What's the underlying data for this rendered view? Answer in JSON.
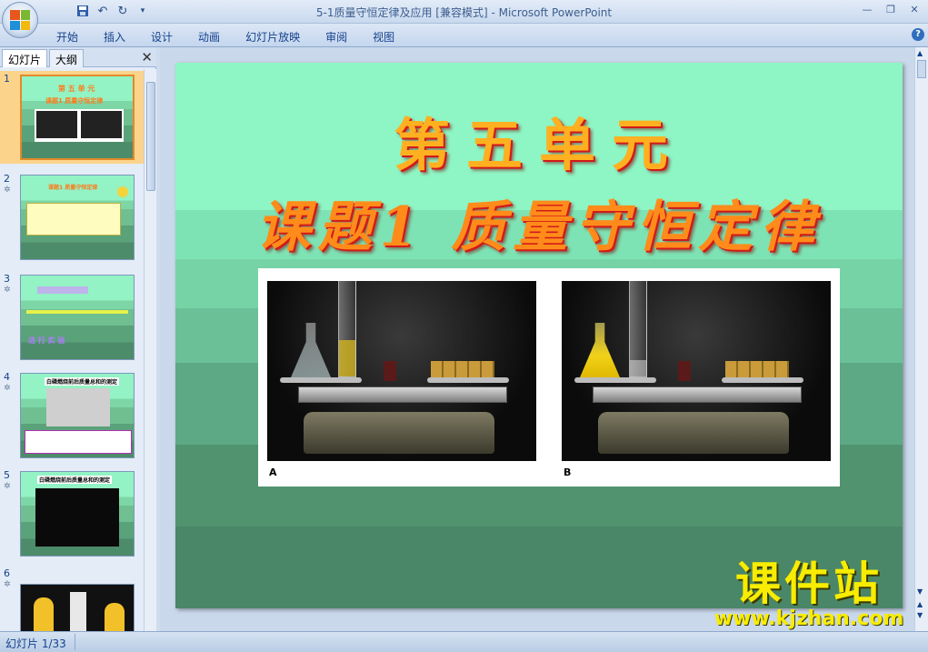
{
  "window": {
    "title": "5-1质量守恒定律及应用 [兼容模式] - Microsoft PowerPoint"
  },
  "quick_access": {
    "icons": [
      "save-icon",
      "undo-icon",
      "redo-icon",
      "customize-icon"
    ]
  },
  "ribbon": {
    "tabs": [
      "开始",
      "插入",
      "设计",
      "动画",
      "幻灯片放映",
      "审阅",
      "视图"
    ]
  },
  "left_pane": {
    "tabs": [
      "幻灯片",
      "大纲"
    ],
    "close_label": "✕",
    "thumbnails": [
      {
        "number": "1",
        "texts": [
          "第 五 单 元",
          "课题1 质量守恒定律"
        ],
        "selected": true
      },
      {
        "number": "2",
        "texts": [
          "课题1 质量守恒定律"
        ]
      },
      {
        "number": "3",
        "texts": [
          "进 行 实 验"
        ]
      },
      {
        "number": "4",
        "texts": [
          "白磷燃烧前后质量总和的测定"
        ]
      },
      {
        "number": "5",
        "texts": [
          "白磷燃烧前后质量总和的测定"
        ]
      },
      {
        "number": "6",
        "texts": []
      }
    ]
  },
  "slide": {
    "title_line1": "第五单元",
    "title_line2": "课题1 质量守恒定律",
    "photo_labels": [
      "A",
      "B"
    ]
  },
  "watermark": {
    "brand": "课件站",
    "url": "www.kjzhan.com"
  },
  "status": {
    "slide_counter": "幻灯片 1/33"
  },
  "colors": {
    "slide_background": "#8ef5c4",
    "title_fill": "#ffb020",
    "title_shadow": "#d11a1a",
    "watermark": "#f8ec00"
  }
}
